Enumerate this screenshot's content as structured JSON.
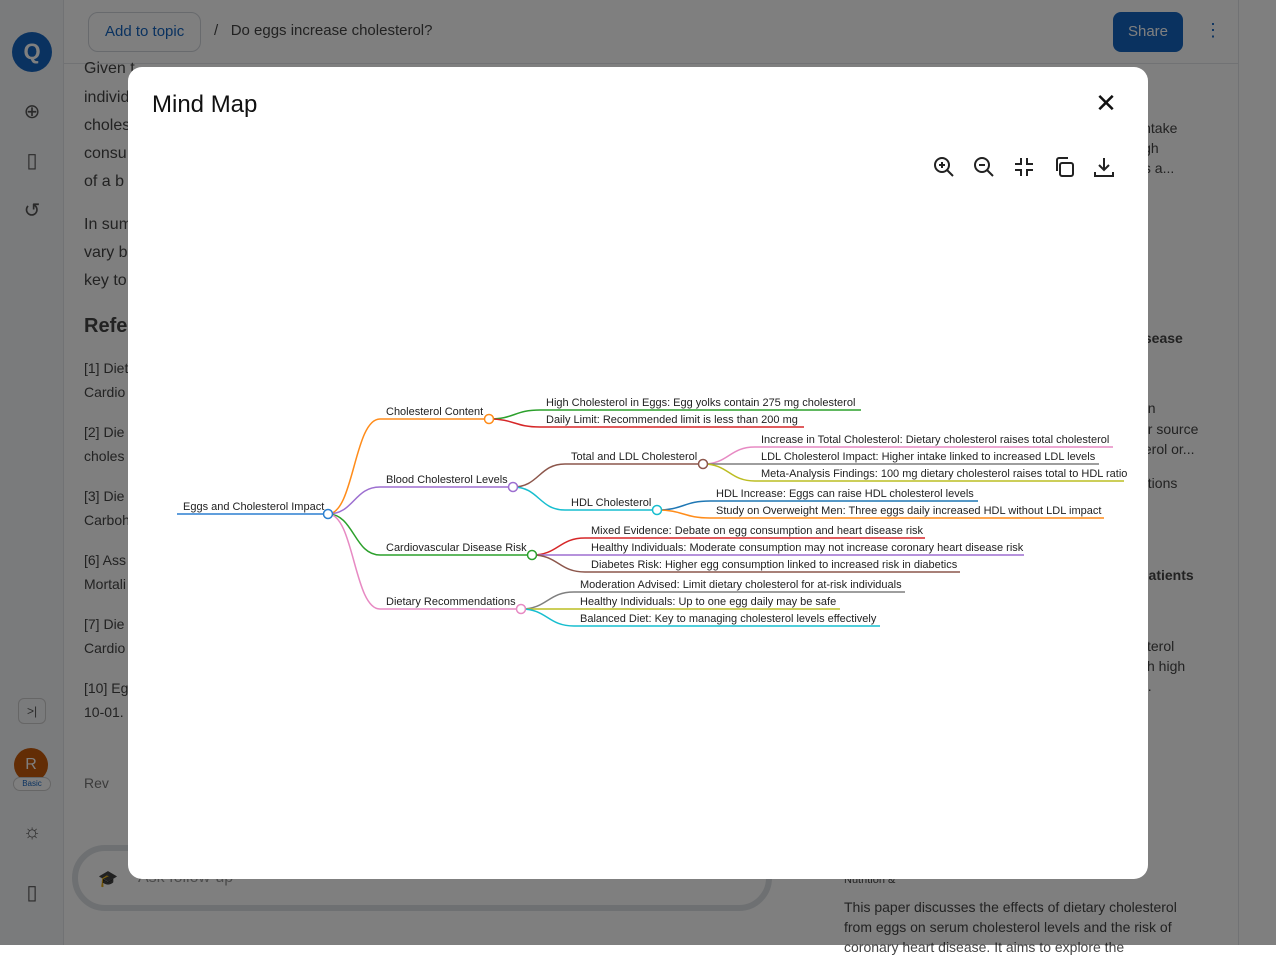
{
  "header": {
    "add_to_topic": "Add to topic",
    "separator": "/",
    "breadcrumb": "Do eggs increase cholesterol?",
    "share": "Share"
  },
  "sidebar": {
    "logo": "Q",
    "avatar_initial": "R",
    "plan_badge": "Basic"
  },
  "background": {
    "body_fragments": [
      "Given t",
      "individ",
      "choles",
      "consu",
      "of a b",
      "In sum",
      "vary b",
      "key to"
    ],
    "references_heading": "Refe",
    "references": [
      "[1] Diet",
      "Cardio",
      "[2] Die",
      "choles",
      "[3] Die",
      "Carboh",
      "[6] Ass",
      "Mortali",
      "[7] Die",
      "Cardio",
      "[10] Eg",
      "10-01. I"
    ],
    "rewrite": "Rev",
    "ask_placeholder": "Ask follow-up",
    "right_fragments": [
      "intake",
      "igh",
      "ts a...",
      "g",
      "isease",
      "on",
      "or source",
      "terol or...",
      "ations",
      "patients",
      "sterol",
      "ith high",
      "...",
      "Nutrition &",
      "This paper discusses the effects of dietary cholesterol",
      "from eggs on serum cholesterol levels and the risk of",
      "coronary heart disease. It aims to explore the"
    ]
  },
  "modal": {
    "title": "Mind Map",
    "tools": [
      "zoom-in-icon",
      "zoom-out-icon",
      "fit-view-icon",
      "copy-icon",
      "download-icon"
    ]
  },
  "mindmap": {
    "root": "Eggs and Cholesterol Impact",
    "colors": {
      "root": "#2b7fd0",
      "orange": "#ff8c1a",
      "purple": "#9d6fd0",
      "green": "#2ca02c",
      "pink": "#e78ac3",
      "red": "#d62728",
      "brown": "#8c564b",
      "cyan": "#17becf",
      "grey": "#7f7f7f",
      "olive": "#bcbd22",
      "blue": "#1f77b4"
    },
    "branches": [
      {
        "label": "Cholesterol Content",
        "children": [
          {
            "label": "High Cholesterol in Eggs: Egg yolks contain 275 mg cholesterol"
          },
          {
            "label": "Daily Limit: Recommended limit is less than 200 mg"
          }
        ]
      },
      {
        "label": "Blood Cholesterol Levels",
        "children": [
          {
            "label": "Total and LDL Cholesterol",
            "children": [
              {
                "label": "Increase in Total Cholesterol: Dietary cholesterol raises total cholesterol"
              },
              {
                "label": "LDL Cholesterol Impact: Higher intake linked to increased LDL levels"
              },
              {
                "label": "Meta-Analysis Findings: 100 mg dietary cholesterol raises total to HDL ratio"
              }
            ]
          },
          {
            "label": "HDL Cholesterol",
            "children": [
              {
                "label": "HDL Increase: Eggs can raise HDL cholesterol levels"
              },
              {
                "label": "Study on Overweight Men: Three eggs daily increased HDL without LDL impact"
              }
            ]
          }
        ]
      },
      {
        "label": "Cardiovascular Disease Risk",
        "children": [
          {
            "label": "Mixed Evidence: Debate on egg consumption and heart disease risk"
          },
          {
            "label": "Healthy Individuals: Moderate consumption may not increase coronary heart disease risk"
          },
          {
            "label": "Diabetes Risk: Higher egg consumption linked to increased risk in diabetics"
          }
        ]
      },
      {
        "label": "Dietary Recommendations",
        "children": [
          {
            "label": "Moderation Advised: Limit dietary cholesterol for at-risk individuals"
          },
          {
            "label": "Healthy Individuals: Up to one egg daily may be safe"
          },
          {
            "label": "Balanced Diet: Key to managing cholesterol levels effectively"
          }
        ]
      }
    ]
  }
}
